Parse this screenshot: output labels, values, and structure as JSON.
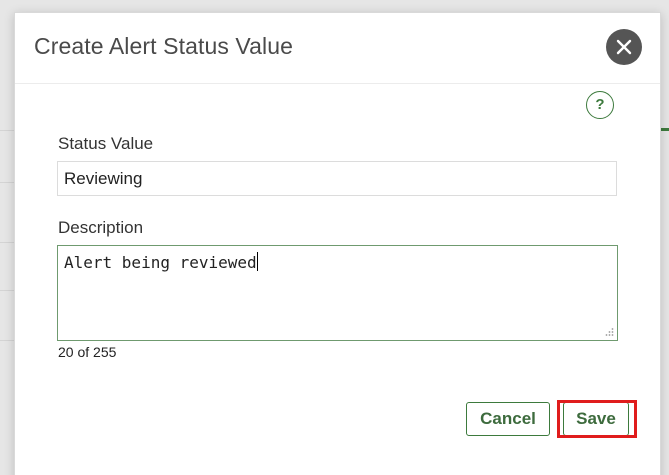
{
  "dialog": {
    "title": "Create Alert Status Value",
    "close_label": "✕",
    "help_label": "?"
  },
  "form": {
    "status_value": {
      "label": "Status Value",
      "value": "Reviewing"
    },
    "description": {
      "label": "Description",
      "value": "Alert being reviewed",
      "char_count": "20 of 255"
    }
  },
  "buttons": {
    "cancel_label": "Cancel",
    "save_label": "Save"
  },
  "colors": {
    "accent": "#3d7a3d",
    "highlight": "#e01c1c",
    "close_bg": "#555555"
  },
  "icons": {
    "close": "close-icon",
    "help": "help-icon",
    "resize": "resize-grip-icon"
  }
}
